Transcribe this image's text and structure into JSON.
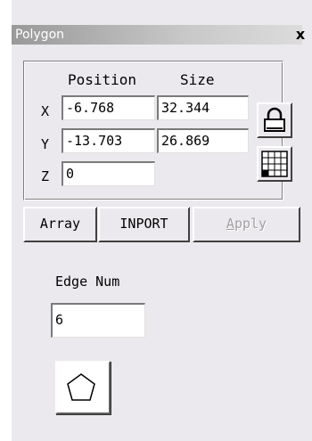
{
  "window": {
    "title": "Polygon",
    "close_label": "x"
  },
  "position_size": {
    "position_header": "Position",
    "size_header": "Size",
    "rows": [
      {
        "axis": "X",
        "position": "-6.768",
        "size": "32.344"
      },
      {
        "axis": "Y",
        "position": "-13.703",
        "size": "26.869"
      },
      {
        "axis": "Z",
        "position": "0"
      }
    ],
    "lock_icon": "padlock-icon",
    "grid_icon": "anchor-grid-icon"
  },
  "buttons": {
    "array": "Array",
    "import": "INPORT",
    "apply": "Apply"
  },
  "edge": {
    "label": "Edge Num",
    "value": "6"
  },
  "shape_icon": "pentagon-icon"
}
